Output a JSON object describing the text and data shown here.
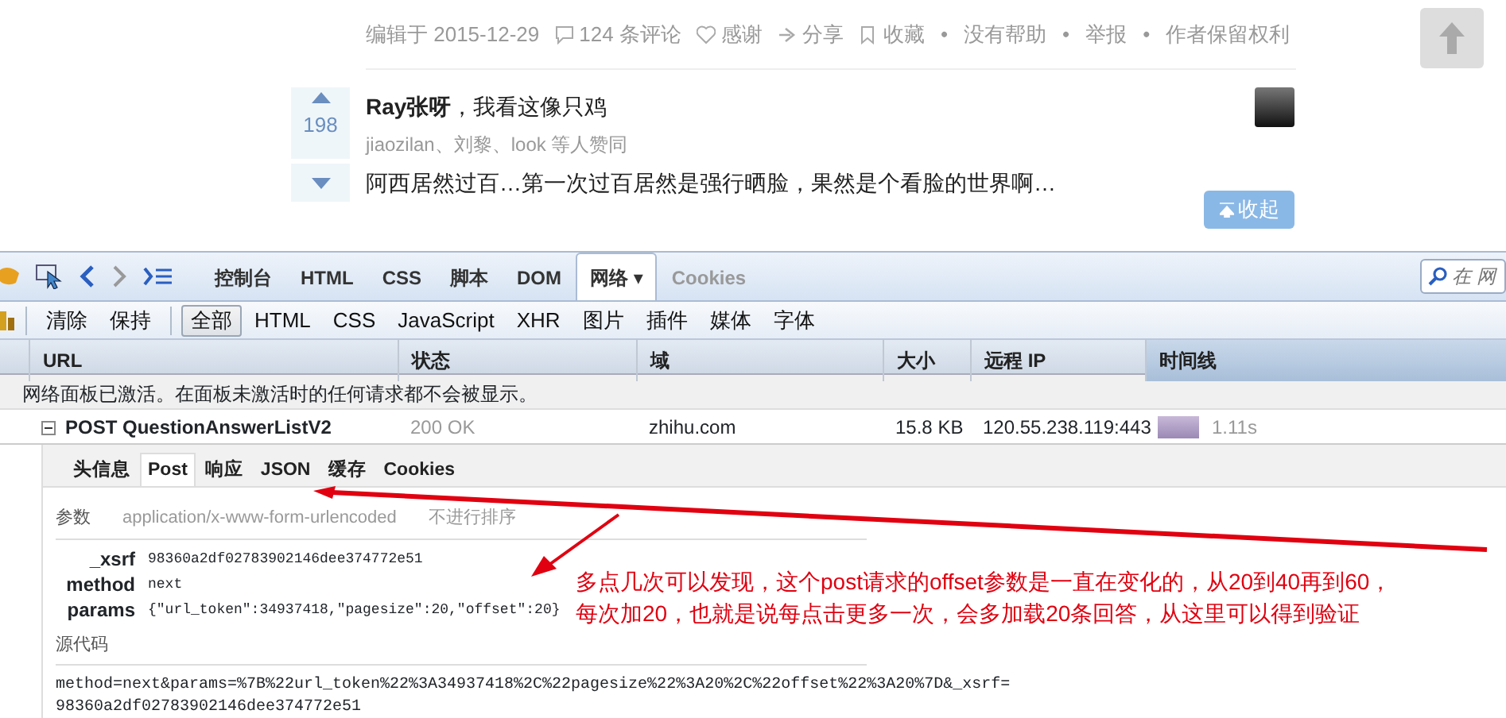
{
  "page": {
    "meta": [
      {
        "kind": "text",
        "text": "编辑于 2015-12-29"
      },
      {
        "kind": "comment",
        "text": "124 条评论"
      },
      {
        "kind": "heart",
        "text": "感谢"
      },
      {
        "kind": "share",
        "text": "分享"
      },
      {
        "kind": "bookmark",
        "text": "收藏"
      },
      {
        "kind": "separator",
        "text": "•"
      },
      {
        "kind": "text",
        "text": "没有帮助"
      },
      {
        "kind": "separator",
        "text": "•"
      },
      {
        "kind": "text",
        "text": "举报"
      },
      {
        "kind": "separator",
        "text": "•"
      },
      {
        "kind": "text",
        "text": "作者保留权利"
      }
    ],
    "answer": {
      "votes": "198",
      "author": "Ray张呀",
      "bio": "，我看这像只鸡",
      "supporters": "jiaozilan、刘黎、look 等人赞同",
      "excerpt": "阿西居然过百…第一次过百居然是强行晒脸，果然是个看脸的世界啊…",
      "collapse_button": "收起"
    }
  },
  "firebug": {
    "panel_tabs": [
      {
        "label": "控制台",
        "selected": false,
        "disabled": false
      },
      {
        "label": "HTML",
        "selected": false,
        "disabled": false
      },
      {
        "label": "CSS",
        "selected": false,
        "disabled": false
      },
      {
        "label": "脚本",
        "selected": false,
        "disabled": false
      },
      {
        "label": "DOM",
        "selected": false,
        "disabled": false
      },
      {
        "label": "网络 ▾",
        "selected": true,
        "disabled": false
      },
      {
        "label": "Cookies",
        "selected": false,
        "disabled": true
      }
    ],
    "search": {
      "placeholder": "在 网"
    },
    "actions": [
      "清除",
      "保持"
    ],
    "filters": [
      {
        "label": "全部",
        "selected": true
      },
      {
        "label": "HTML",
        "selected": false
      },
      {
        "label": "CSS",
        "selected": false
      },
      {
        "label": "JavaScript",
        "selected": false
      },
      {
        "label": "XHR",
        "selected": false
      },
      {
        "label": "图片",
        "selected": false
      },
      {
        "label": "插件",
        "selected": false
      },
      {
        "label": "媒体",
        "selected": false
      },
      {
        "label": "字体",
        "selected": false
      }
    ],
    "columns": [
      {
        "label": "URL",
        "sorted": false
      },
      {
        "label": "状态",
        "sorted": false
      },
      {
        "label": "域",
        "sorted": false
      },
      {
        "label": "大小",
        "sorted": false
      },
      {
        "label": "远程 IP",
        "sorted": false
      },
      {
        "label": "时间线",
        "sorted": true
      }
    ],
    "notice": "网络面板已激活。在面板未激活时的任何请求都不会被显示。",
    "request": {
      "expanded": true,
      "url": "POST QuestionAnswerListV2",
      "status": "200 OK",
      "domain": "zhihu.com",
      "size": "15.8 KB",
      "remote_ip": "120.55.238.119:443",
      "time": "1.11s"
    },
    "detail_tabs": [
      {
        "label": "头信息",
        "selected": false
      },
      {
        "label": "Post",
        "selected": true
      },
      {
        "label": "响应",
        "selected": false
      },
      {
        "label": "JSON",
        "selected": false
      },
      {
        "label": "缓存",
        "selected": false
      },
      {
        "label": "Cookies",
        "selected": false
      }
    ],
    "params_header": {
      "title": "参数",
      "encoding": "application/x-www-form-urlencoded",
      "sort_link": "不进行排序"
    },
    "params": [
      {
        "name": "_xsrf",
        "value": "98360a2df02783902146dee374772e51"
      },
      {
        "name": "method",
        "value": "next"
      },
      {
        "name": "params",
        "value": "{\"url_token\":34937418,\"pagesize\":20,\"offset\":20}"
      }
    ],
    "source_title": "源代码",
    "source_lines": [
      "method=next&params=%7B%22url_token%22%3A34937418%2C%22pagesize%22%3A20%2C%22offset%22%3A20%7D&_xsrf=",
      "98360a2df02783902146dee374772e51"
    ]
  },
  "annotation": {
    "lines": [
      "多点几次可以发现，这个post请求的offset参数是一直在变化的，从20到40再到60，",
      "每次加20，也就是说每点击更多一次，会多加载20条回答，从这里可以得到验证"
    ]
  }
}
